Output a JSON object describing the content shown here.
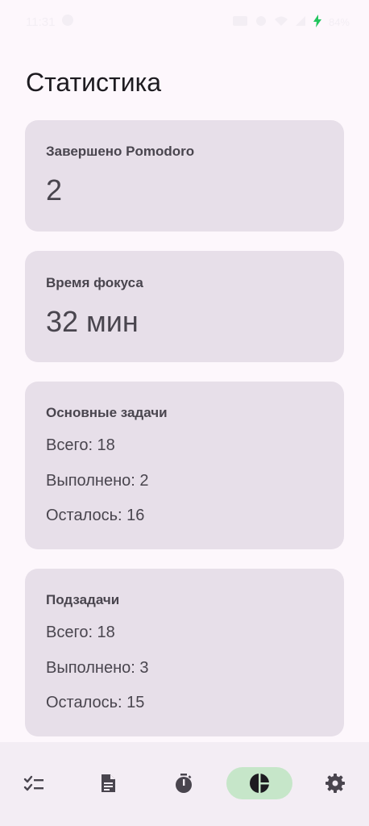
{
  "status_bar": {
    "time": "11:31",
    "battery": "84%"
  },
  "page": {
    "title": "Статистика"
  },
  "cards": {
    "pomodoro": {
      "label": "Завершено Pomodoro",
      "value": "2"
    },
    "focus_time": {
      "label": "Время фокуса",
      "value": "32 мин"
    },
    "main_tasks": {
      "label": "Основные задачи",
      "total": "Всего: 18",
      "done": "Выполнено: 2",
      "left": "Осталось: 16"
    },
    "subtasks": {
      "label": "Подзадачи",
      "total": "Всего: 18",
      "done": "Выполнено: 3",
      "left": "Осталось: 15"
    }
  },
  "nav": {
    "items": [
      {
        "icon": "checklist-icon"
      },
      {
        "icon": "document-icon"
      },
      {
        "icon": "timer-icon"
      },
      {
        "icon": "statistics-pie-icon",
        "active": true
      },
      {
        "icon": "settings-gear-icon"
      }
    ],
    "active_color": "#c6e6c9"
  }
}
